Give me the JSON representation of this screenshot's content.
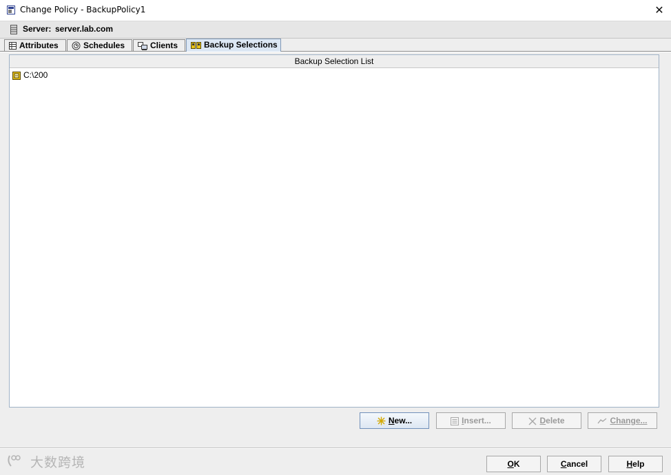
{
  "window": {
    "title": "Change Policy - BackupPolicy1",
    "close_label": "✕"
  },
  "server": {
    "label": "Server:",
    "value": "server.lab.com"
  },
  "tabs": [
    {
      "label": "Attributes",
      "icon": "table-icon",
      "active": false
    },
    {
      "label": "Schedules",
      "icon": "clock-icon",
      "active": false
    },
    {
      "label": "Clients",
      "icon": "computer-icon",
      "active": false
    },
    {
      "label": "Backup Selections",
      "icon": "backup-selection-icon",
      "active": true
    }
  ],
  "list": {
    "header": "Backup Selection List",
    "items": [
      {
        "label": "C:\\200",
        "icon": "folder-path-icon"
      }
    ]
  },
  "actions": {
    "new": {
      "first": "N",
      "rest": "ew...",
      "icon": "new-star-icon",
      "enabled": true
    },
    "insert": {
      "first": "I",
      "rest": "nsert...",
      "icon": "insert-icon",
      "enabled": false
    },
    "delete": {
      "first": "D",
      "rest": "elete",
      "icon": "delete-x-icon",
      "enabled": false
    },
    "change": {
      "first": "",
      "rest": "Change...",
      "icon": "change-icon",
      "enabled": false
    }
  },
  "footer": {
    "ok": {
      "first": "O",
      "rest": "K"
    },
    "cancel": {
      "first": "C",
      "rest": "ancel"
    },
    "help": {
      "first": "H",
      "rest": "elp"
    }
  },
  "watermark": "大数跨境",
  "colors": {
    "active_tab_bg": "#dce7f4",
    "frame_border": "#9fb2c6",
    "primary_button_border": "#6f8fb9",
    "disabled_text": "#9a9a9a"
  }
}
